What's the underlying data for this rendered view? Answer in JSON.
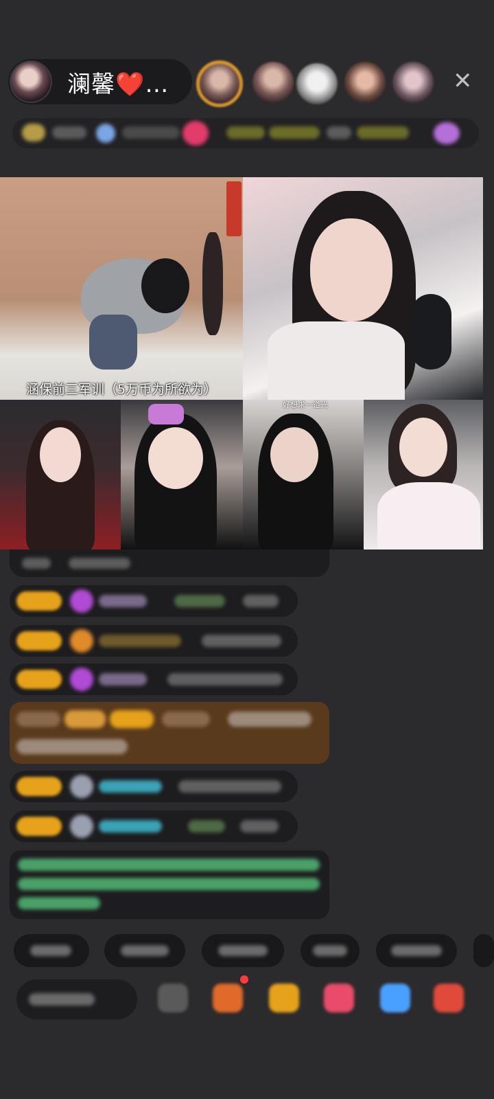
{
  "host": {
    "name": "澜馨❤️…"
  },
  "videos": {
    "caption": "涵保前三军训（5万币为所欲为）",
    "small_tag": "好想求一道光"
  },
  "colors": {
    "background": "#2b2a2c",
    "badge_gold": "#e6a21a",
    "gift_purple": "#b14bd6",
    "username_teal": "#3aa3b5",
    "system_green": "#54c27b",
    "highlight_brown": "#5a3a1c"
  },
  "icons": {
    "close": "close-icon",
    "gift": "gift-icon",
    "more": "more-icon"
  }
}
